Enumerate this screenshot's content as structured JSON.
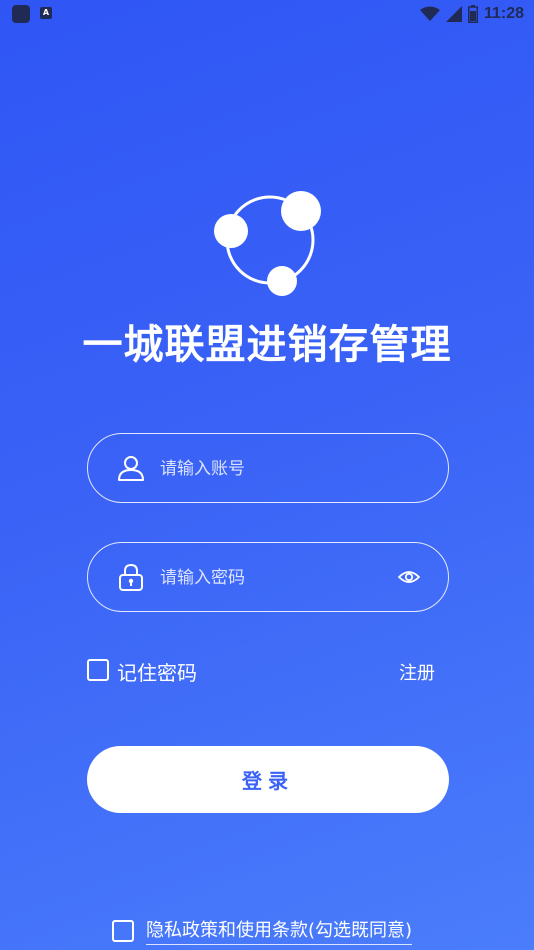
{
  "status_bar": {
    "time": "11:28",
    "icons": [
      "app-notification-icon",
      "a-notification-icon",
      "wifi-icon",
      "signal-icon",
      "battery-icon"
    ]
  },
  "app": {
    "title": "一城联盟进销存管理",
    "logo_icon": "share-nodes-logo"
  },
  "login_form": {
    "account_placeholder": "请输入账号",
    "account_value": "",
    "account_icon": "user-icon",
    "password_placeholder": "请输入密码",
    "password_value": "",
    "password_icon": "lock-icon",
    "show_password_icon": "eye-icon",
    "remember_label": "记住密码",
    "remember_checked": false,
    "register_label": "注册",
    "login_button_label": "登录"
  },
  "privacy": {
    "checked": false,
    "label": "隐私政策和使用条款(勾选既同意)"
  },
  "colors": {
    "background_start": "#2f56f5",
    "background_end": "#4a7dfb",
    "button_text": "#3a62f6",
    "foreground": "#ffffff"
  }
}
